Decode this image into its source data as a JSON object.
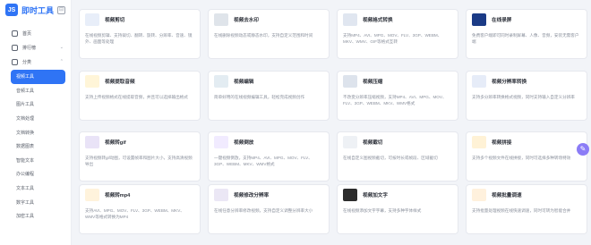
{
  "brand": {
    "logo_text": "JS",
    "name": "即时工具"
  },
  "nav": [
    {
      "label": "首页"
    },
    {
      "label": "排行榜"
    },
    {
      "label": "分类"
    }
  ],
  "categories": [
    "视频工具",
    "音频工具",
    "图片工具",
    "文档处理",
    "文档转换",
    "数据图表",
    "智能文本",
    "办公编程",
    "文本工具",
    "数字工具",
    "加密工具"
  ],
  "active_category": "视频工具",
  "cards": [
    {
      "title": "视频剪切",
      "desc": "在线视频剪辑、支持裁切、翻转、旋转、分辨率、音速、镜外、画面等处理",
      "color": "#e8eef9"
    },
    {
      "title": "视频去水印",
      "desc": "在线删除视频动态或静态水印，支持自定义范围和时间",
      "color": "#dfe4ea"
    },
    {
      "title": "视频格式转换",
      "desc": "支持MP4、AVI、MPG、MOV、FLV、3GP、WEBM、MKV、WMV、GIF等格式互转",
      "color": "#e0e6f0"
    },
    {
      "title": "在线录屏",
      "desc": "免费客户端即可同时录制屏幕、人像、音频，安装无需客户端",
      "color": "#1b3b86"
    },
    {
      "title": "视频提取音频",
      "desc": "支持上传视频格式在线提取音频，并且可以选择输出格式",
      "color": "#fff5d8"
    },
    {
      "title": "视频编辑",
      "desc": "简单好用的在线视频编辑工具，轻松完成视频创作",
      "color": "#e3ecf2"
    },
    {
      "title": "视频压缩",
      "desc": "不改变分辨率压缩视频，支持MP4、AVI、MPG、MOV、FLV、3GP、WEBM、MKV、WMV格式",
      "color": "#dde3ec"
    },
    {
      "title": "视频分辨率转换",
      "desc": "支持多分辨率转换格式视频，同时支持输入自定义分辨率",
      "color": "#e6ecf8"
    },
    {
      "title": "视频转gif",
      "desc": "支持视频转gif动图，可设置帧率和图片大小，支持高清视频导出",
      "color": "#e9e3f7"
    },
    {
      "title": "视频倒放",
      "desc": "一键视频倒放，支持MP4、AVI、MPG、MOV、FLV、3GP、WEBM、MKV、WMV格式",
      "color": "#f1ebff"
    },
    {
      "title": "视频截切",
      "desc": "在线自定义图视频截切，可按时长或帧段、区域截切",
      "color": "#eef1f5"
    },
    {
      "title": "视频拼接",
      "desc": "支持多个视频文件在线拼接，同时可选择多种转场特效",
      "color": "#fff2d6"
    },
    {
      "title": "视频转mp4",
      "desc": "支持AVI、MPG、MOV、FLV、3GP、WEBM、MKV、WMV等格式转换为MP4",
      "color": "#fff3dc"
    },
    {
      "title": "视频修改分辨率",
      "desc": "在线任意分辨率修改视频，支持自定义调整分辨率大小",
      "color": "#ebe7f5"
    },
    {
      "title": "视频加文字",
      "desc": "在线视频添加文字字幕，支持多种字体样式",
      "color": "#2c2c2c"
    },
    {
      "title": "视频批量调速",
      "desc": "支持批量处理视频在线快速调速，同时可转为智能合并",
      "color": "#fff1dd"
    }
  ]
}
